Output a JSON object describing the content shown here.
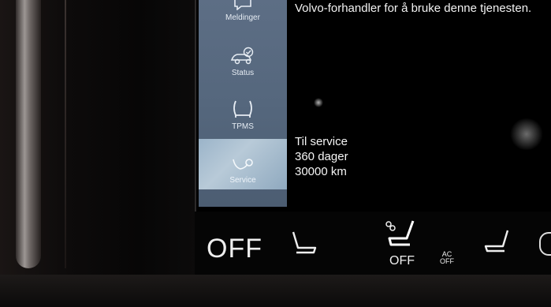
{
  "sidebar": {
    "items": [
      {
        "label": "Meldinger",
        "icon": "messages-icon"
      },
      {
        "label": "Status",
        "icon": "car-check-icon"
      },
      {
        "label": "TPMS",
        "icon": "tire-pressure-icon"
      },
      {
        "label": "Service",
        "icon": "service-wrench-icon",
        "active": true
      }
    ]
  },
  "main": {
    "dealer_text": "Volvo-forhandler for å bruke denne tjenesten.",
    "service": {
      "title": "Til service",
      "days": "360 dager",
      "distance": "30000 km"
    }
  },
  "climate": {
    "left_off": "OFF",
    "center_off": "OFF",
    "ac_top": "AC",
    "ac_bottom": "OFF"
  },
  "colors": {
    "sidebar": "#55677d",
    "active_item": "#b8cad8",
    "text": "#f2f2f2"
  }
}
